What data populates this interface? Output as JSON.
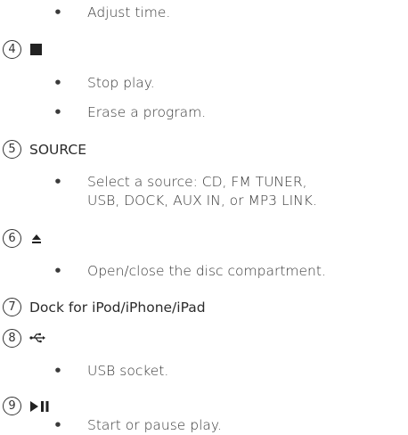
{
  "items": [
    {
      "bullets": [
        "Adjust time."
      ]
    },
    {
      "number": "4",
      "icon": "stop-icon",
      "bullets": [
        "Stop play.",
        "Erase a program."
      ]
    },
    {
      "number": "5",
      "label": "SOURCE",
      "bullets": [
        "Select a source: CD, FM TUNER,",
        "USB, DOCK, AUX IN, or MP3 LINK."
      ]
    },
    {
      "number": "6",
      "icon": "eject-icon",
      "bullets": [
        "Open/close the disc compartment."
      ]
    },
    {
      "number": "7",
      "label": "Dock for iPod/iPhone/iPad"
    },
    {
      "number": "8",
      "icon": "usb-icon",
      "bullets": [
        "USB socket."
      ]
    },
    {
      "number": "9",
      "icon": "play-pause-icon",
      "bullets": [
        "Start or pause play."
      ]
    }
  ],
  "bullet_glyph": "•"
}
